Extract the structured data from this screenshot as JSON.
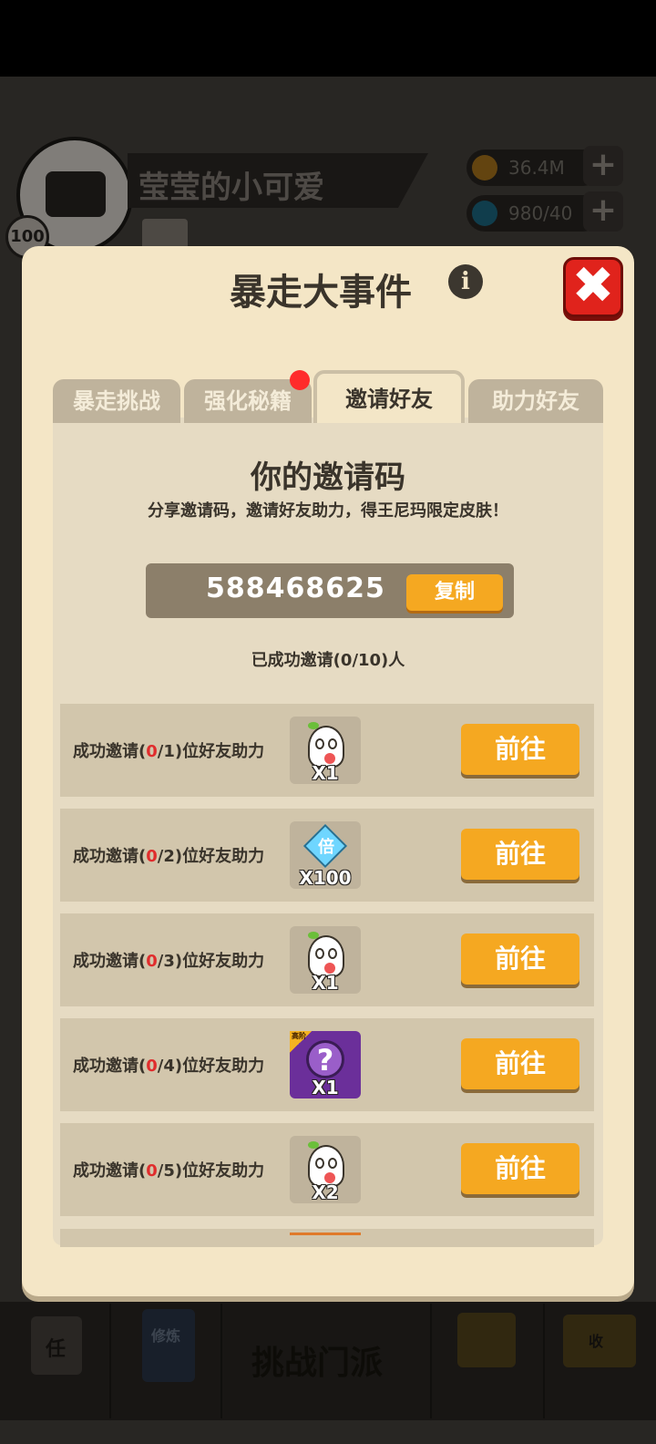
{
  "hud": {
    "player_name": "莹莹的小可爱",
    "level": "100",
    "gold": "36.4M",
    "energy": "980/40",
    "bottom_nav": {
      "task_icon_text": "任",
      "cultivate_icon_text": "修炼",
      "center_label": "挑战门派",
      "collect_icon_text": "收"
    }
  },
  "modal": {
    "title": "暴走大事件",
    "info_icon": "i",
    "close_icon": "✖",
    "tabs": [
      {
        "label": "暴走挑战"
      },
      {
        "label": "强化秘籍"
      },
      {
        "label": "邀请好友"
      },
      {
        "label": "助力好友"
      }
    ],
    "active_tab": "邀请好友",
    "invite": {
      "title": "你的邀请码",
      "description": "分享邀请码，邀请好友助力，得王尼玛限定皮肤！",
      "code": "588468625",
      "copy_label": "复制",
      "invited_text": "已成功邀请(0/10)人"
    },
    "tasks": [
      {
        "prefix": "成功邀请(",
        "done": "0",
        "rest": "/1)位好友助力",
        "reward_icon": "ghost-icon",
        "reward_qty": "X1",
        "button": "前往"
      },
      {
        "prefix": "成功邀请(",
        "done": "0",
        "rest": "/2)位好友助力",
        "reward_icon": "multiplier-diamond-icon",
        "reward_text": "倍",
        "reward_qty": "X100",
        "button": "前往"
      },
      {
        "prefix": "成功邀请(",
        "done": "0",
        "rest": "/3)位好友助力",
        "reward_icon": "ghost-icon",
        "reward_qty": "X1",
        "button": "前往"
      },
      {
        "prefix": "成功邀请(",
        "done": "0",
        "rest": "/4)位好友助力",
        "reward_icon": "mystery-box-icon",
        "reward_text": "?",
        "reward_tag": "高阶",
        "reward_qty": "X1",
        "button": "前往"
      },
      {
        "prefix": "成功邀请(",
        "done": "0",
        "rest": "/5)位好友助力",
        "reward_icon": "ghost-icon",
        "reward_qty": "X2",
        "button": "前往"
      }
    ]
  },
  "colors": {
    "accent_button": "#f5a821",
    "close_red": "#e0231c",
    "modal_bg": "#f4e6c6",
    "progress_red": "#e02d2d"
  }
}
